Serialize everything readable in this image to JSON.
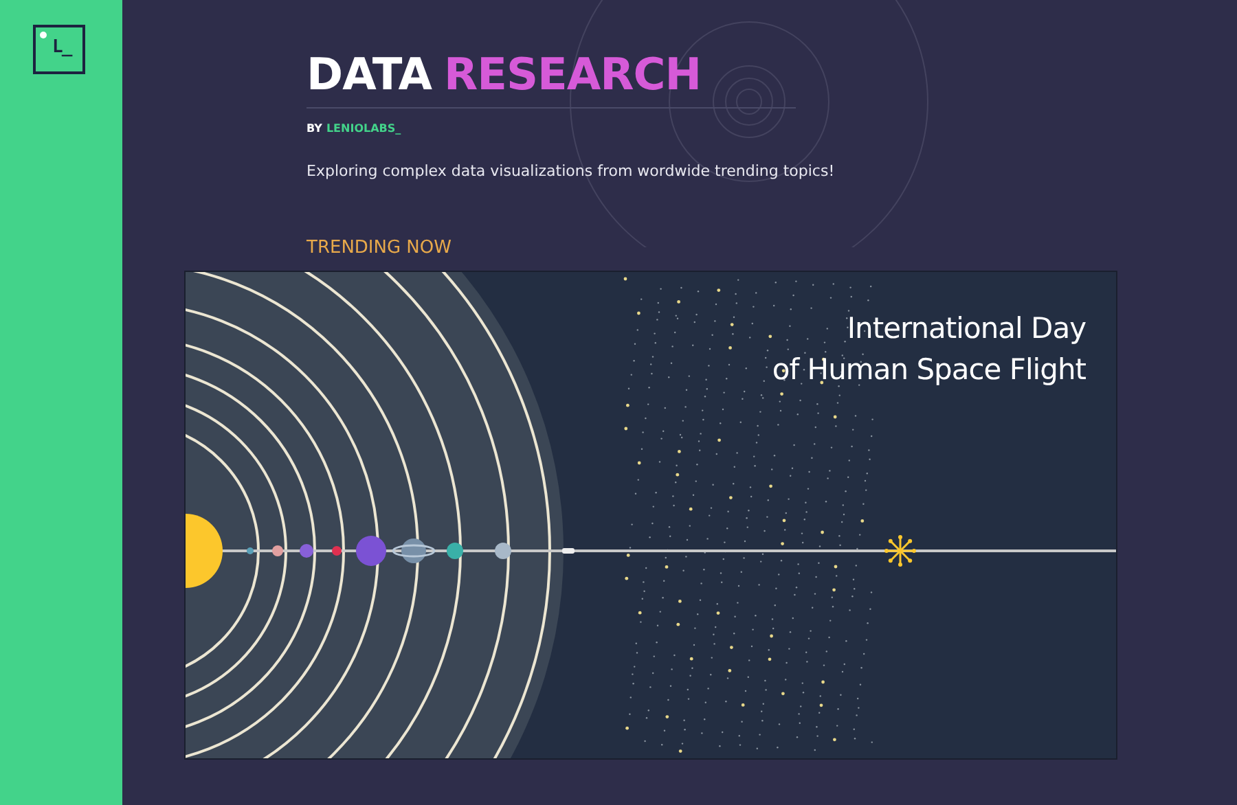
{
  "sidebar": {
    "logo": "L_"
  },
  "header": {
    "title_parts": [
      {
        "text": "DATA",
        "kind": "plain"
      },
      {
        "text": "RESEARCH",
        "kind": "accent"
      }
    ],
    "byline_parts": [
      {
        "text": "BY",
        "kind": "plain"
      },
      {
        "text": "LENIOLABS_",
        "kind": "accent"
      }
    ],
    "description": "Exploring complex data visualizations from wordwide trending topics!"
  },
  "trending": {
    "heading": "TRENDING NOW",
    "card": {
      "title_lines": [
        "International Day",
        "of Human Space Flight"
      ]
    }
  }
}
